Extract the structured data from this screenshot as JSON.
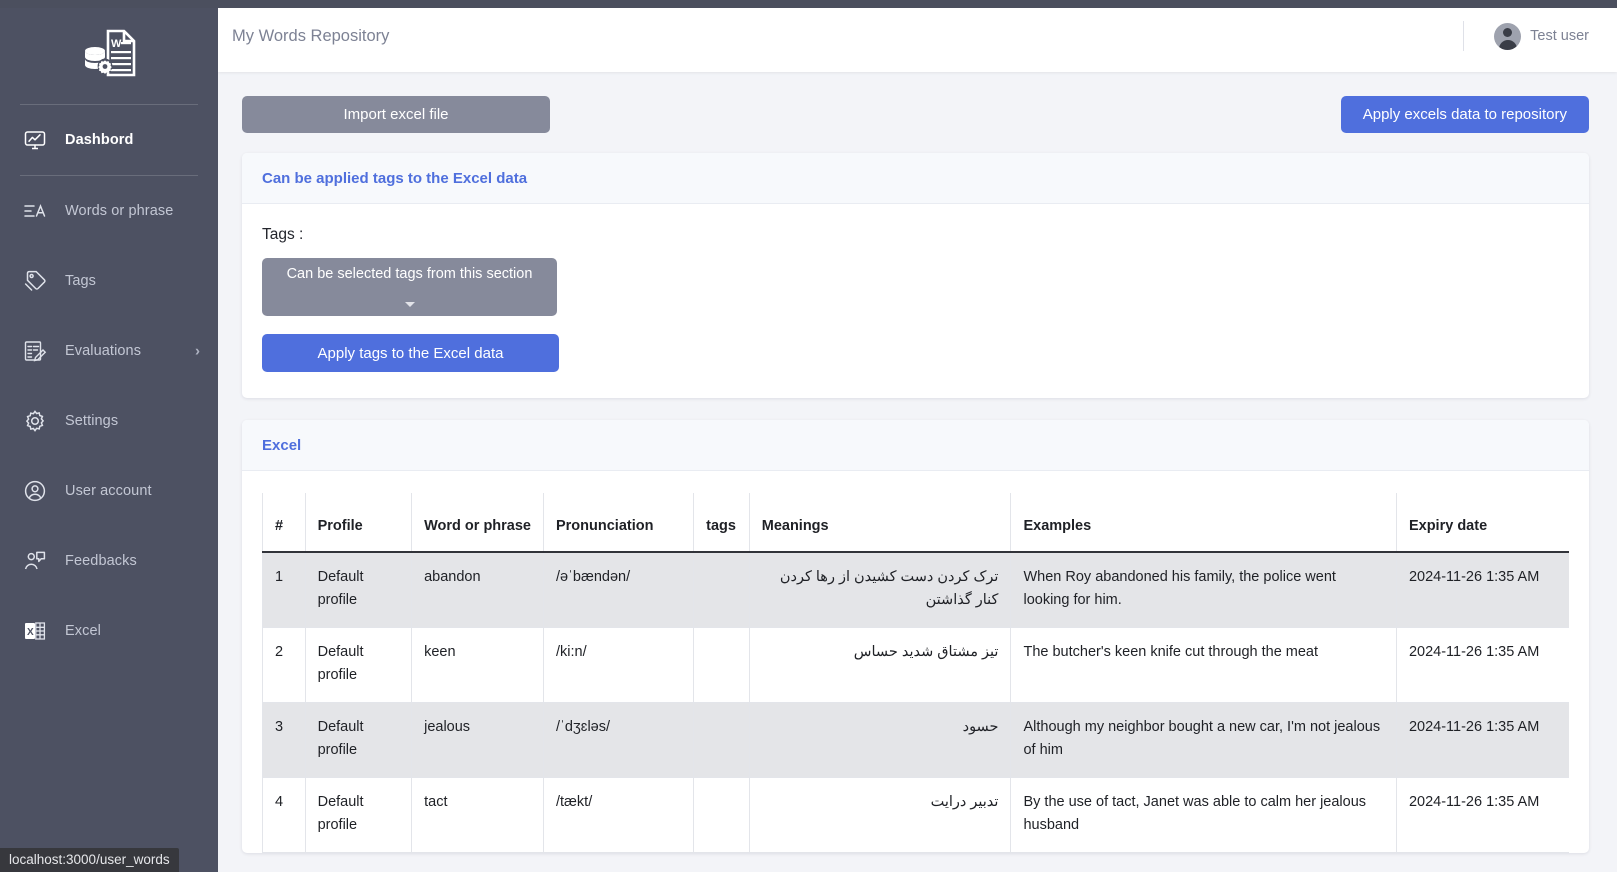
{
  "status_bar": {
    "url": "localhost:3000/user_words"
  },
  "sidebar": {
    "logo_icon": "database-document-gear-icon",
    "items": [
      {
        "label": "Dashbord",
        "icon": "monitor-chart-icon",
        "active": true,
        "has_chevron": false
      },
      {
        "label": "Words or phrase",
        "icon": "list-text-a-icon",
        "active": false,
        "has_chevron": false
      },
      {
        "label": "Tags",
        "icon": "tag-icon",
        "active": false,
        "has_chevron": false
      },
      {
        "label": "Evaluations",
        "icon": "exam-paper-pencil-icon",
        "active": false,
        "has_chevron": true
      },
      {
        "label": "Settings",
        "icon": "gear-icon",
        "active": false,
        "has_chevron": false
      },
      {
        "label": "User account",
        "icon": "user-circle-icon",
        "active": false,
        "has_chevron": false
      },
      {
        "label": "Feedbacks",
        "icon": "user-speech-bubble-icon",
        "active": false,
        "has_chevron": false
      },
      {
        "label": "Excel",
        "icon": "excel-file-icon",
        "active": false,
        "has_chevron": false
      }
    ]
  },
  "header": {
    "title": "My Words Repository",
    "user_name": "Test user",
    "avatar_icon": "user-avatar-icon"
  },
  "toolbar": {
    "import_label": "Import excel file",
    "apply_repo_label": "Apply excels data to repository"
  },
  "tags_card": {
    "title": "Can be applied tags to the Excel data",
    "tags_label": "Tags :",
    "select_value": "Can be selected tags from this section",
    "select_caret_icon": "chevron-down-icon",
    "apply_tags_label": "Apply tags to the Excel data"
  },
  "excel_card": {
    "title": "Excel",
    "columns": [
      "#",
      "Profile",
      "Word or phrase",
      "Pronunciation",
      "tags",
      "Meanings",
      "Examples",
      "Expiry date"
    ],
    "rows": [
      {
        "num": "1",
        "profile": "Default profile",
        "word": "abandon",
        "pronunciation": "/əˈbændən/",
        "tags": "",
        "meanings": "ترک کردن دست کشیدن از رها کردن کنار گذاشتن",
        "examples": "When Roy abandoned his family, the police went looking for him.",
        "expiry": "2024-11-26 1:35 AM"
      },
      {
        "num": "2",
        "profile": "Default profile",
        "word": "keen",
        "pronunciation": "/ki:n/",
        "tags": "",
        "meanings": "تیز مشتاق شدید حساس",
        "examples": "The butcher's keen knife cut through the meat",
        "expiry": "2024-11-26 1:35 AM"
      },
      {
        "num": "3",
        "profile": "Default profile",
        "word": "jealous",
        "pronunciation": "/ˈdʒɛləs/",
        "tags": "",
        "meanings": "حسود",
        "examples": "Although my neighbor bought a new car, I'm not jealous of him",
        "expiry": "2024-11-26 1:35 AM"
      },
      {
        "num": "4",
        "profile": "Default profile",
        "word": "tact",
        "pronunciation": "/tækt/",
        "tags": "",
        "meanings": "تدبیر درایت",
        "examples": "By the use of tact, Janet was able to calm her jealous husband",
        "expiry": "2024-11-26 1:35 AM"
      }
    ]
  },
  "colors": {
    "sidebar_bg": "#4d5162",
    "accent_blue": "#4f6fdd",
    "muted_gray": "#868a9b",
    "page_bg": "#f3f4f8",
    "row_alt": "#e4e5e8"
  }
}
